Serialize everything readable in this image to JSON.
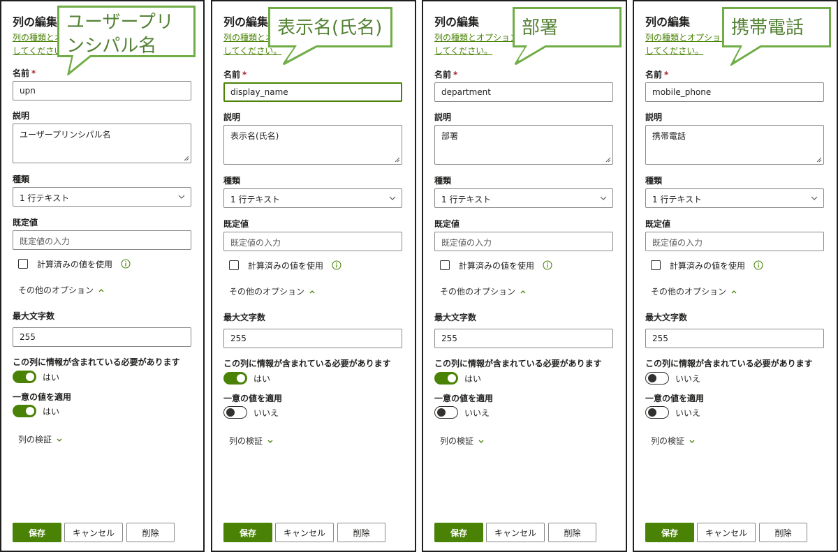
{
  "common": {
    "panel_title": "列の編集",
    "desc_line1": "列の種類とオプションを選択",
    "desc_line2": "してください。",
    "name_label": "名前",
    "required_mark": "*",
    "description_label": "説明",
    "type_label": "種類",
    "type_value": "1 行テキスト",
    "default_label": "既定値",
    "default_placeholder": "既定値の入力",
    "calc_checkbox_label": "計算済みの値を使用",
    "more_options_label": "その他のオプション",
    "max_chars_label": "最大文字数",
    "max_chars_value": "255",
    "required_label": "この列に情報が含まれている必要があります",
    "unique_label": "一意の値を適用",
    "validation_label": "列の検証",
    "save_label": "保存",
    "cancel_label": "キャンセル",
    "delete_label": "削除"
  },
  "panels": [
    {
      "callout": "ユーザープリンシパル名",
      "name_value": "upn",
      "description_value": "ユーザープリンシパル名",
      "required_toggle": "はい",
      "unique_toggle": "はい"
    },
    {
      "callout": "表示名(氏名)",
      "name_value": "display_name",
      "description_value": "表示名(氏名)",
      "required_toggle": "はい",
      "unique_toggle": "いいえ"
    },
    {
      "callout": "部署",
      "name_value": "department",
      "description_value": "部署",
      "required_toggle": "はい",
      "unique_toggle": "いいえ"
    },
    {
      "callout": "携帯電話",
      "name_value": "mobile_phone",
      "description_value": "携帯電話",
      "required_toggle": "いいえ",
      "unique_toggle": "いいえ"
    }
  ],
  "colors": {
    "accent": "#498205",
    "callout_border": "#70ad47",
    "callout_text": "#548235"
  },
  "icons": {
    "dropdown": "chevron-down-icon",
    "info": "info-icon",
    "expander_open": "chevron-up-icon",
    "expander_closed": "chevron-down-icon"
  }
}
